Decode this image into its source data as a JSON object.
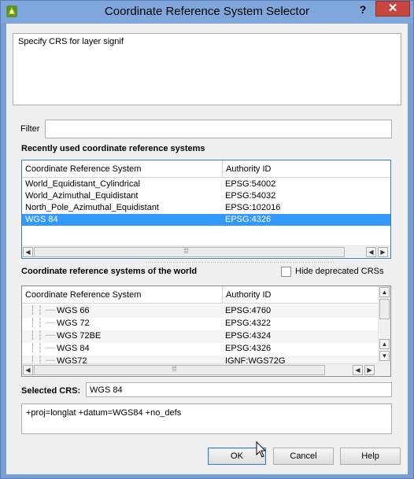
{
  "window": {
    "title": "Coordinate Reference System Selector",
    "help_label": "?",
    "close_label": "✕"
  },
  "message": "Specify CRS for layer signif",
  "filter": {
    "label": "Filter",
    "value": ""
  },
  "recent": {
    "title": "Recently used coordinate reference systems",
    "columns": [
      "Coordinate Reference System",
      "Authority ID"
    ],
    "rows": [
      {
        "name": "World_Equidistant_Cylindrical",
        "id": "EPSG:54002"
      },
      {
        "name": "World_Azimuthal_Equidistant",
        "id": "EPSG:54032"
      },
      {
        "name": "North_Pole_Azimuthal_Equidistant",
        "id": "EPSG:102016"
      },
      {
        "name": "WGS 84",
        "id": "EPSG:4326",
        "selected": true
      }
    ]
  },
  "world": {
    "title": "Coordinate reference systems of the world",
    "hide_deprecated_label": "Hide deprecated CRSs",
    "hide_deprecated_checked": false,
    "columns": [
      "Coordinate Reference System",
      "Authority ID"
    ],
    "rows": [
      {
        "name": "WGS 66",
        "id": "EPSG:4760"
      },
      {
        "name": "WGS 72",
        "id": "EPSG:4322"
      },
      {
        "name": "WGS 72BE",
        "id": "EPSG:4324"
      },
      {
        "name": "WGS 84",
        "id": "EPSG:4326"
      },
      {
        "name": "WGS72",
        "id": "IGNF:WGS72G"
      }
    ]
  },
  "selected_crs": {
    "label": "Selected CRS:",
    "value": "WGS 84"
  },
  "proj_string": "+proj=longlat +datum=WGS84 +no_defs",
  "buttons": {
    "ok": "OK",
    "cancel": "Cancel",
    "help": "Help"
  },
  "icons": {
    "app": "qgis-logo-icon",
    "scroll_left": "◀",
    "scroll_right": "▶",
    "scroll_up": "▲",
    "scroll_down": "▼",
    "grip": "⁞⁞⁞⁞"
  },
  "colors": {
    "selection": "#3399ff",
    "close_button": "#c7463d",
    "titlebar": "#7fa7dc"
  }
}
